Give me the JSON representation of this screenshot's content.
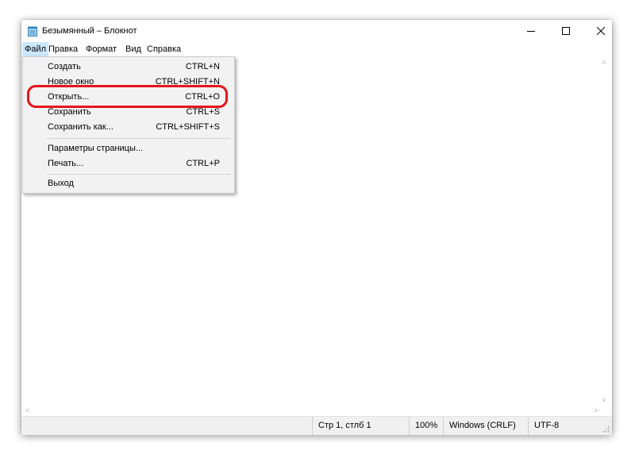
{
  "window": {
    "title": "Безымянный – Блокнот",
    "app_icon": "notepad-icon",
    "buttons": {
      "minimize": "–",
      "maximize": "☐",
      "close": "✕"
    }
  },
  "menubar": {
    "items": [
      {
        "label": "Файл",
        "active": true
      },
      {
        "label": "Правка"
      },
      {
        "label": "Формат"
      },
      {
        "label": "Вид"
      },
      {
        "label": "Справка"
      }
    ]
  },
  "file_menu": {
    "items": [
      {
        "label": "Создать",
        "shortcut": "CTRL+N"
      },
      {
        "label": "Новое окно",
        "shortcut": "CTRL+SHIFT+N"
      },
      {
        "label": "Открыть...",
        "shortcut": "CTRL+O",
        "highlighted": true
      },
      {
        "label": "Сохранить",
        "shortcut": "CTRL+S"
      },
      {
        "label": "Сохранить как...",
        "shortcut": "CTRL+SHIFT+S"
      },
      {
        "label": "Параметры страницы..."
      },
      {
        "label": "Печать...",
        "shortcut": "CTRL+P"
      },
      {
        "label": "Выход"
      }
    ]
  },
  "statusbar": {
    "position": "Стр 1, стлб 1",
    "zoom": "100%",
    "line_ending": "Windows (CRLF)",
    "encoding": "UTF-8"
  },
  "colors": {
    "highlight_outline": "#e8131b",
    "menu_active": "#cce8ff",
    "menu_background": "#f2f2f2"
  }
}
